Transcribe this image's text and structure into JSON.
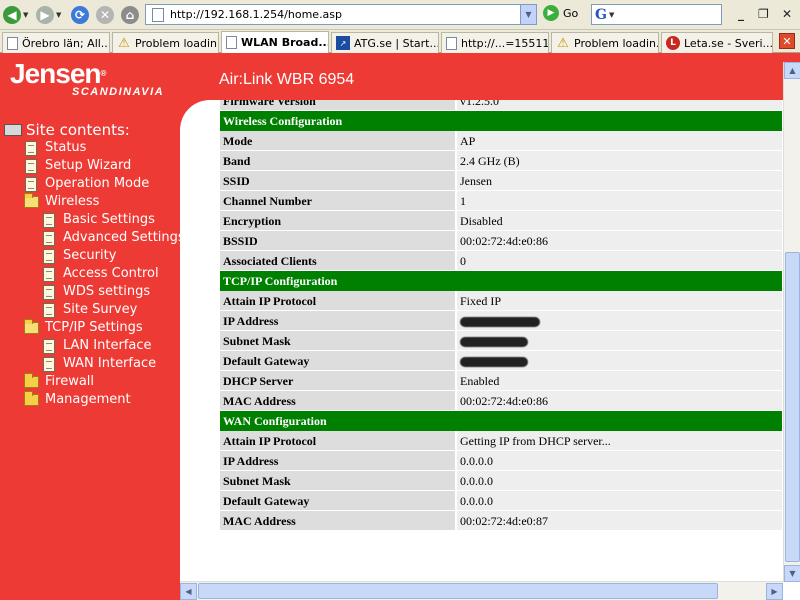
{
  "browser": {
    "address": "http://192.168.1.254/home.asp",
    "go_label": "Go",
    "search_value": "",
    "icons": [
      "back-arrow-icon",
      "forward-arrow-icon",
      "refresh-icon",
      "stop-icon",
      "home-icon",
      "page-icon",
      "go-icon",
      "google-icon"
    ]
  },
  "tabs": [
    {
      "label": "Örebro län; All...",
      "icon": "page-icon"
    },
    {
      "label": "Problem loadin...",
      "icon": "warning-icon"
    },
    {
      "label": "WLAN Broad...",
      "icon": "page-icon",
      "active": true
    },
    {
      "label": "ATG.se | Start...",
      "icon": "atg-icon"
    },
    {
      "label": "http://...=15511",
      "icon": "page-icon"
    },
    {
      "label": "Problem loadin...",
      "icon": "warning-icon"
    },
    {
      "label": "Leta.se - Sveri...",
      "icon": "leta-icon"
    }
  ],
  "header": {
    "brand": "Jensen",
    "brand_mark": "®",
    "sub": "SCANDINAVIA",
    "model": "Air:Link WBR 6954"
  },
  "sidebar": {
    "title": "Site contents:",
    "items": [
      {
        "label": "Status"
      },
      {
        "label": "Setup Wizard"
      },
      {
        "label": "Operation Mode"
      },
      {
        "label": "Wireless"
      },
      {
        "label": "Basic Settings"
      },
      {
        "label": "Advanced Settings"
      },
      {
        "label": "Security"
      },
      {
        "label": "Access Control"
      },
      {
        "label": "WDS settings"
      },
      {
        "label": "Site Survey"
      },
      {
        "label": "TCP/IP Settings"
      },
      {
        "label": "LAN Interface"
      },
      {
        "label": "WAN Interface"
      },
      {
        "label": "Firewall"
      },
      {
        "label": "Management"
      }
    ]
  },
  "status": {
    "partial_row": {
      "label": "Firmware Version",
      "value": "v1.2.5.0"
    },
    "wireless": {
      "title": "Wireless Configuration",
      "rows": [
        {
          "label": "Mode",
          "value": "AP"
        },
        {
          "label": "Band",
          "value": "2.4 GHz (B)"
        },
        {
          "label": "SSID",
          "value": "Jensen"
        },
        {
          "label": "Channel Number",
          "value": "1"
        },
        {
          "label": "Encryption",
          "value": "Disabled"
        },
        {
          "label": "BSSID",
          "value": "00:02:72:4d:e0:86"
        },
        {
          "label": "Associated Clients",
          "value": "0"
        }
      ]
    },
    "tcpip": {
      "title": "TCP/IP Configuration",
      "rows": [
        {
          "label": "Attain IP Protocol",
          "value": "Fixed IP"
        },
        {
          "label": "IP Address",
          "value": ""
        },
        {
          "label": "Subnet Mask",
          "value": ""
        },
        {
          "label": "Default Gateway",
          "value": ""
        },
        {
          "label": "DHCP Server",
          "value": "Enabled"
        },
        {
          "label": "MAC Address",
          "value": "00:02:72:4d:e0:86"
        }
      ]
    },
    "wan": {
      "title": "WAN Configuration",
      "rows": [
        {
          "label": "Attain IP Protocol",
          "value": "Getting IP from DHCP server..."
        },
        {
          "label": "IP Address",
          "value": "0.0.0.0"
        },
        {
          "label": "Subnet Mask",
          "value": "0.0.0.0"
        },
        {
          "label": "Default Gateway",
          "value": "0.0.0.0"
        },
        {
          "label": "MAC Address",
          "value": "00:02:72:4d:e0:87"
        }
      ]
    }
  }
}
